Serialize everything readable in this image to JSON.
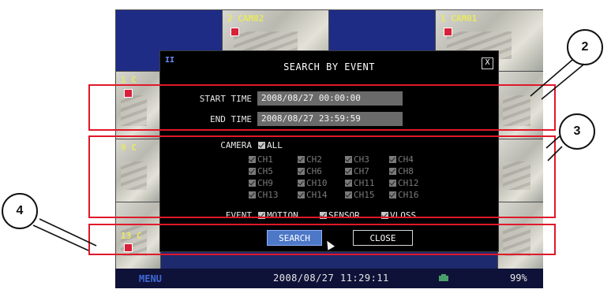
{
  "dialog": {
    "title": "SEARCH BY EVENT",
    "pause_glyph": "II",
    "close_glyph": "X",
    "start_time_label": "START TIME",
    "start_time_value": "2008/08/27 00:00:00",
    "end_time_label": "END TIME",
    "end_time_value": "2008/08/27 23:59:59",
    "camera_label": "CAMERA",
    "all_label": "ALL",
    "channels": [
      "CH1",
      "CH2",
      "CH3",
      "CH4",
      "CH5",
      "CH6",
      "CH7",
      "CH8",
      "CH9",
      "CH10",
      "CH11",
      "CH12",
      "CH13",
      "CH14",
      "CH15",
      "CH16"
    ],
    "event_label": "EVENT",
    "event_options": [
      "MOTION",
      "SENSOR",
      "VLOSS"
    ],
    "search_button": "SEARCH",
    "close_button": "CLOSE"
  },
  "status_bar": {
    "menu_label": "MENU",
    "datetime": "2008/08/27 11:29:11",
    "hdd_percent": "99%",
    "hdd_icon": "hdd-icon"
  },
  "tiles": {
    "cam2_label": "2 CAM02",
    "cam1_label": "1 CAM01",
    "rec_label": "REC",
    "side_labels": [
      "1 C",
      "5 C",
      "9 C",
      "13 C"
    ]
  },
  "callouts": [
    "2",
    "3",
    "4"
  ],
  "colors": {
    "highlight_red": "#e0182a",
    "dialog_bg": "#000000",
    "search_button_bg": "#4d78c8",
    "field_bg": "#6a6a6a"
  }
}
